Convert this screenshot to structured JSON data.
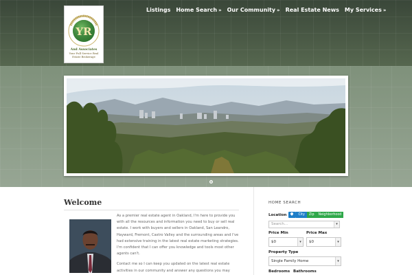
{
  "logo": {
    "lines": [
      "Youngblood Realty",
      "YR",
      "And Associates",
      "Your Full Service Real",
      "Estate Brokerage"
    ]
  },
  "nav": [
    {
      "label": "Listings",
      "dropdown": false
    },
    {
      "label": "Home Search",
      "dropdown": true
    },
    {
      "label": "Our Community",
      "dropdown": true
    },
    {
      "label": "Real Estate News",
      "dropdown": false
    },
    {
      "label": "My Services",
      "dropdown": true
    }
  ],
  "slider": {
    "current": 1,
    "total": 1
  },
  "welcome": {
    "title": "Welcome",
    "paragraph1": "As a premier real estate agent in Oakland, I'm here to provide you with all the resources and information you need to buy or sell real estate. I work with buyers and sellers in Oakland, San Leandro, Hayward, Fremont, Castro Valley and the surrounding areas and I've had extensive training in the latest real estate marketing strategies.  I'm confident that I can offer you knowledge and tools most other agents can't.",
    "paragraph2": "Contact me so I can keep you updated on the latest real estate activities in our community and answer any questions you may have."
  },
  "home_search": {
    "title": "HOME SEARCH",
    "location_label": "Location",
    "location_tabs": [
      "City",
      "Zip",
      "Neighborhood"
    ],
    "search_placeholder": "Search...",
    "price_min_label": "Price Min",
    "price_min_value": "$0",
    "price_max_label": "Price Max",
    "price_max_value": "$0",
    "property_type_label": "Property Type",
    "property_type_value": "Single Family Home",
    "bedrooms_label": "Bedrooms",
    "bathrooms_label": "Bathrooms"
  },
  "colors": {
    "header_bg": "#4a5a48",
    "hero_bg": "#8e9e8a",
    "city_tab": "#1f7fc9",
    "zip_tab": "#2fa84a"
  }
}
